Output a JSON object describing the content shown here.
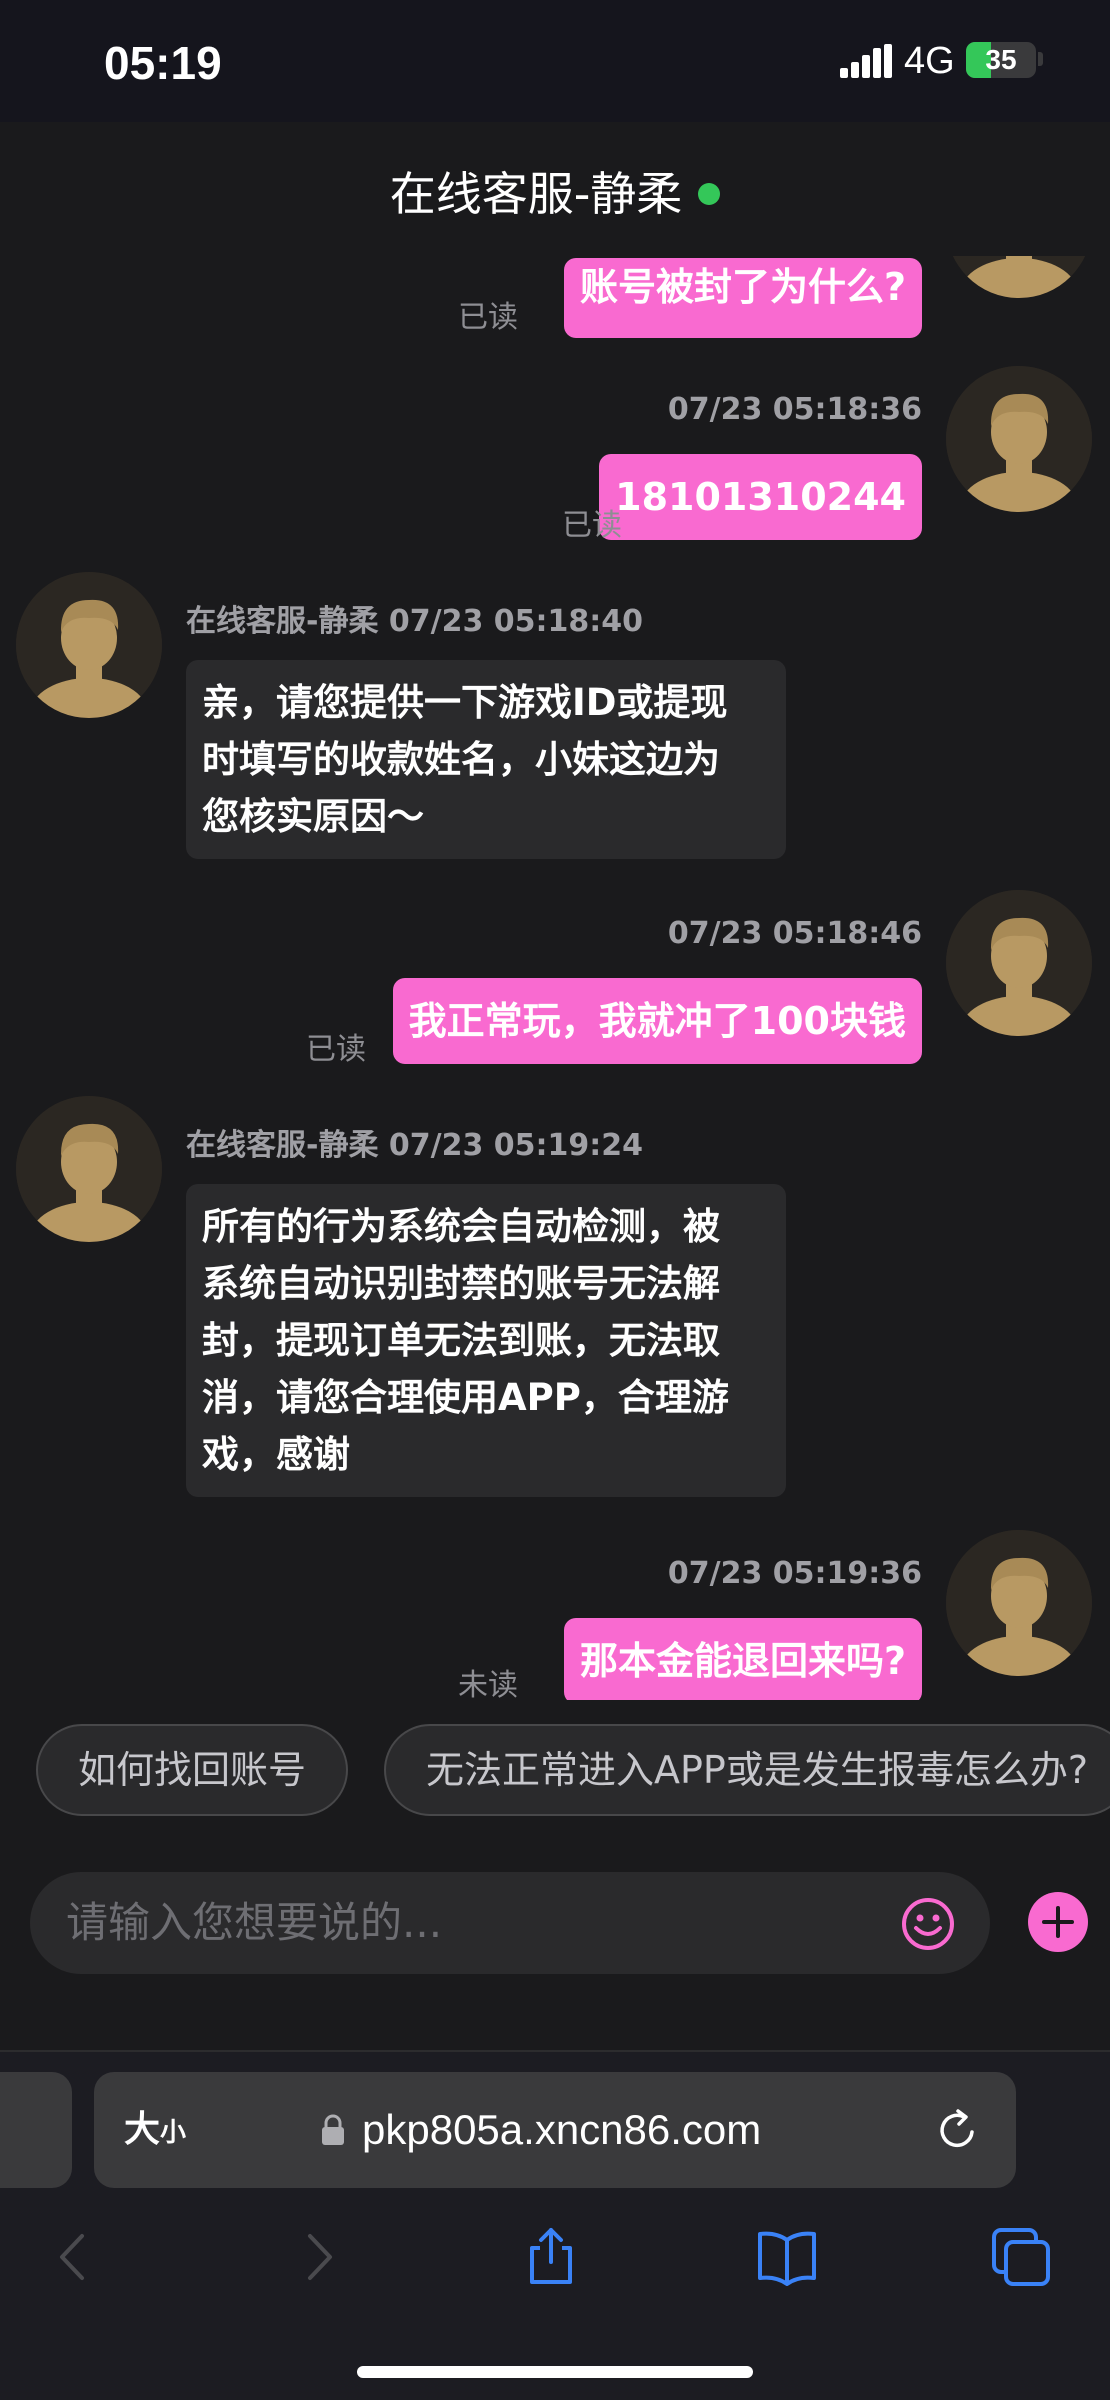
{
  "status_bar": {
    "time": "05:19",
    "network": "4G",
    "battery": "35",
    "battery_level_percent": 35,
    "battery_color": "#34c759"
  },
  "header": {
    "title": "在线客服-静柔",
    "online_color": "#34c759"
  },
  "messages": [
    {
      "direction": "out",
      "text": "账号被封了为什么?",
      "status": "已读"
    },
    {
      "direction": "out",
      "time": "07/23 05:18:36",
      "text": "18101310244",
      "status": "已读"
    },
    {
      "direction": "in",
      "sender": "在线客服-静柔",
      "time": "07/23 05:18:40",
      "lines": [
        "亲，请您提供一下游戏ID或提现",
        "时填写的收款姓名，小妹这边为",
        "您核实原因～"
      ]
    },
    {
      "direction": "out",
      "time": "07/23 05:18:46",
      "text": "我正常玩，我就冲了100块钱",
      "status": "已读"
    },
    {
      "direction": "in",
      "sender": "在线客服-静柔",
      "time": "07/23 05:19:24",
      "lines": [
        "所有的行为系统会自动检测，被",
        "系统自动识别封禁的账号无法解",
        "封，提现订单无法到账，无法取",
        "消，请您合理使用APP，合理游",
        "戏，感谢"
      ]
    },
    {
      "direction": "out",
      "time": "07/23 05:19:36",
      "text": "那本金能退回来吗?",
      "status": "未读"
    }
  ],
  "quick_replies": [
    "如何找回账号",
    "无法正常进入APP或是发生报毒怎么办?"
  ],
  "input": {
    "placeholder": "请输入您想要说的...",
    "emoji_icon": "smiley-icon",
    "plus_icon": "plus-icon"
  },
  "browser": {
    "text_size_big": "大",
    "text_size_small": "小",
    "url": "pkp805a.xncn86.com",
    "accent_color": "#3a82f7"
  },
  "colors": {
    "outgoing_bubble": "#f96ad0",
    "incoming_bubble": "#2a2a2c",
    "background": "#1a1a1c"
  }
}
